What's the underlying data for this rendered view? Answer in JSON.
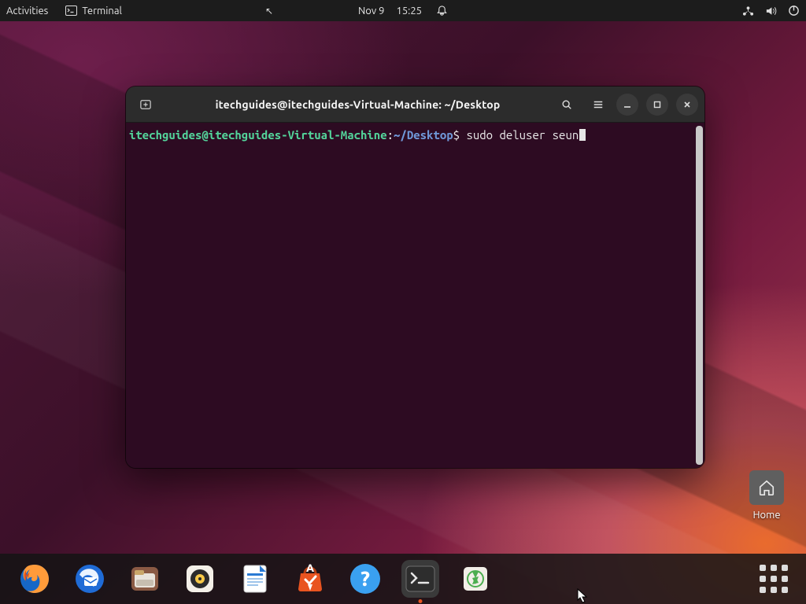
{
  "panel": {
    "activities": "Activities",
    "app_label": "Terminal",
    "date": "Nov 9",
    "time": "15:25"
  },
  "terminal": {
    "title": "itechguides@itechguides-Virtual-Machine: ~/Desktop",
    "prompt_user_host": "itechguides@itechguides-Virtual-Machine",
    "prompt_path": "~/Desktop",
    "prompt_symbol": "$",
    "command": "sudo deluser seun"
  },
  "desktop": {
    "home_label": "Home"
  },
  "dock": {
    "items": [
      "firefox",
      "thunderbird",
      "files",
      "rhythmbox",
      "libreoffice-writer",
      "software",
      "help",
      "terminal",
      "trash"
    ]
  }
}
